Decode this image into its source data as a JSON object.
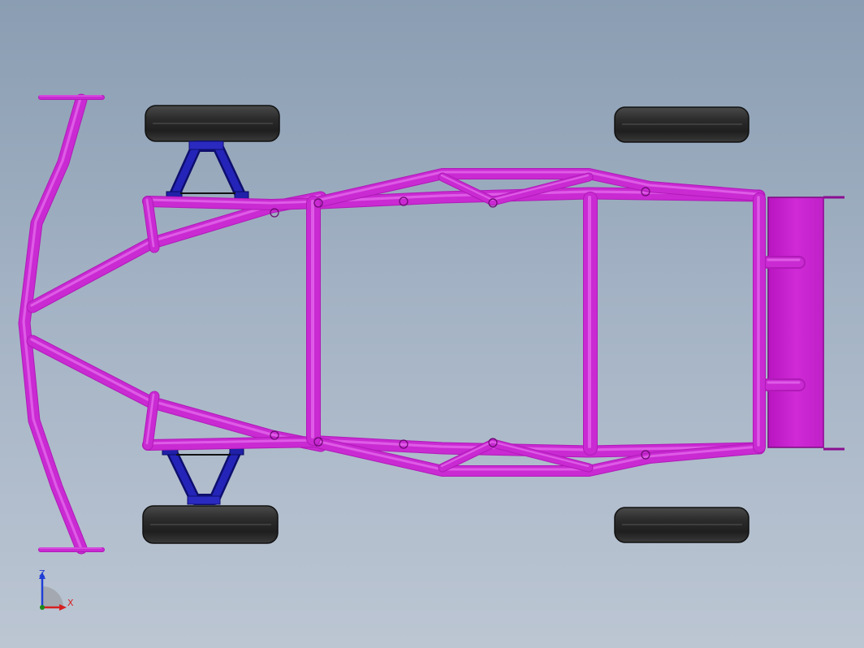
{
  "viewport": {
    "background_top": "#8a9db2",
    "background_bottom": "#bcc6d3"
  },
  "model": {
    "frame_color": "#c92ad2",
    "suspension_color": "#1f1fa8",
    "tire_color": "#2a2a2a",
    "panel_color": "#c51ccc"
  },
  "triad": {
    "z_label": "Z",
    "x_label": "X",
    "z_color": "#1f3fd6",
    "x_color": "#d62020"
  }
}
